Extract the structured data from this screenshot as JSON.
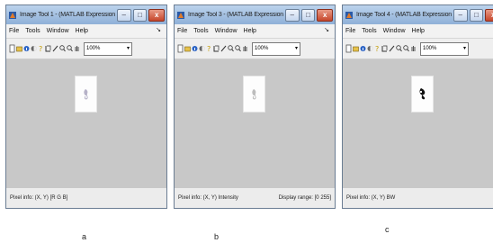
{
  "windows": [
    {
      "title": "Image Tool 1 - (MATLAB Expression)",
      "menu": [
        "File",
        "Tools",
        "Window",
        "Help"
      ],
      "zoom": "100%",
      "pixel_info": "Pixel info: (X, Y) [R G B]",
      "display_range": "",
      "caption": "a"
    },
    {
      "title": "Image Tool 3 - (MATLAB Expression)",
      "menu": [
        "File",
        "Tools",
        "Window",
        "Help"
      ],
      "zoom": "100%",
      "pixel_info": "Pixel info: (X, Y) Intensity",
      "display_range": "Display range: [0 255]",
      "caption": "b"
    },
    {
      "title": "Image Tool 4 - (MATLAB Expression)",
      "menu": [
        "File",
        "Tools",
        "Window",
        "Help"
      ],
      "zoom": "100%",
      "pixel_info": "Pixel info: (X, Y) BW",
      "display_range": "",
      "caption": "c"
    }
  ],
  "window_controls": {
    "minimize": "–",
    "maximize": "□",
    "close": "x"
  },
  "menu_pin": "↘",
  "zoom_arrow": "▾",
  "toolbar_icons": [
    "new-icon",
    "open-icon",
    "info-icon",
    "adjust-contrast-icon",
    "help-icon",
    "crop-icon",
    "distance-tool-icon",
    "zoom-in-icon",
    "zoom-out-icon",
    "pan-icon"
  ]
}
